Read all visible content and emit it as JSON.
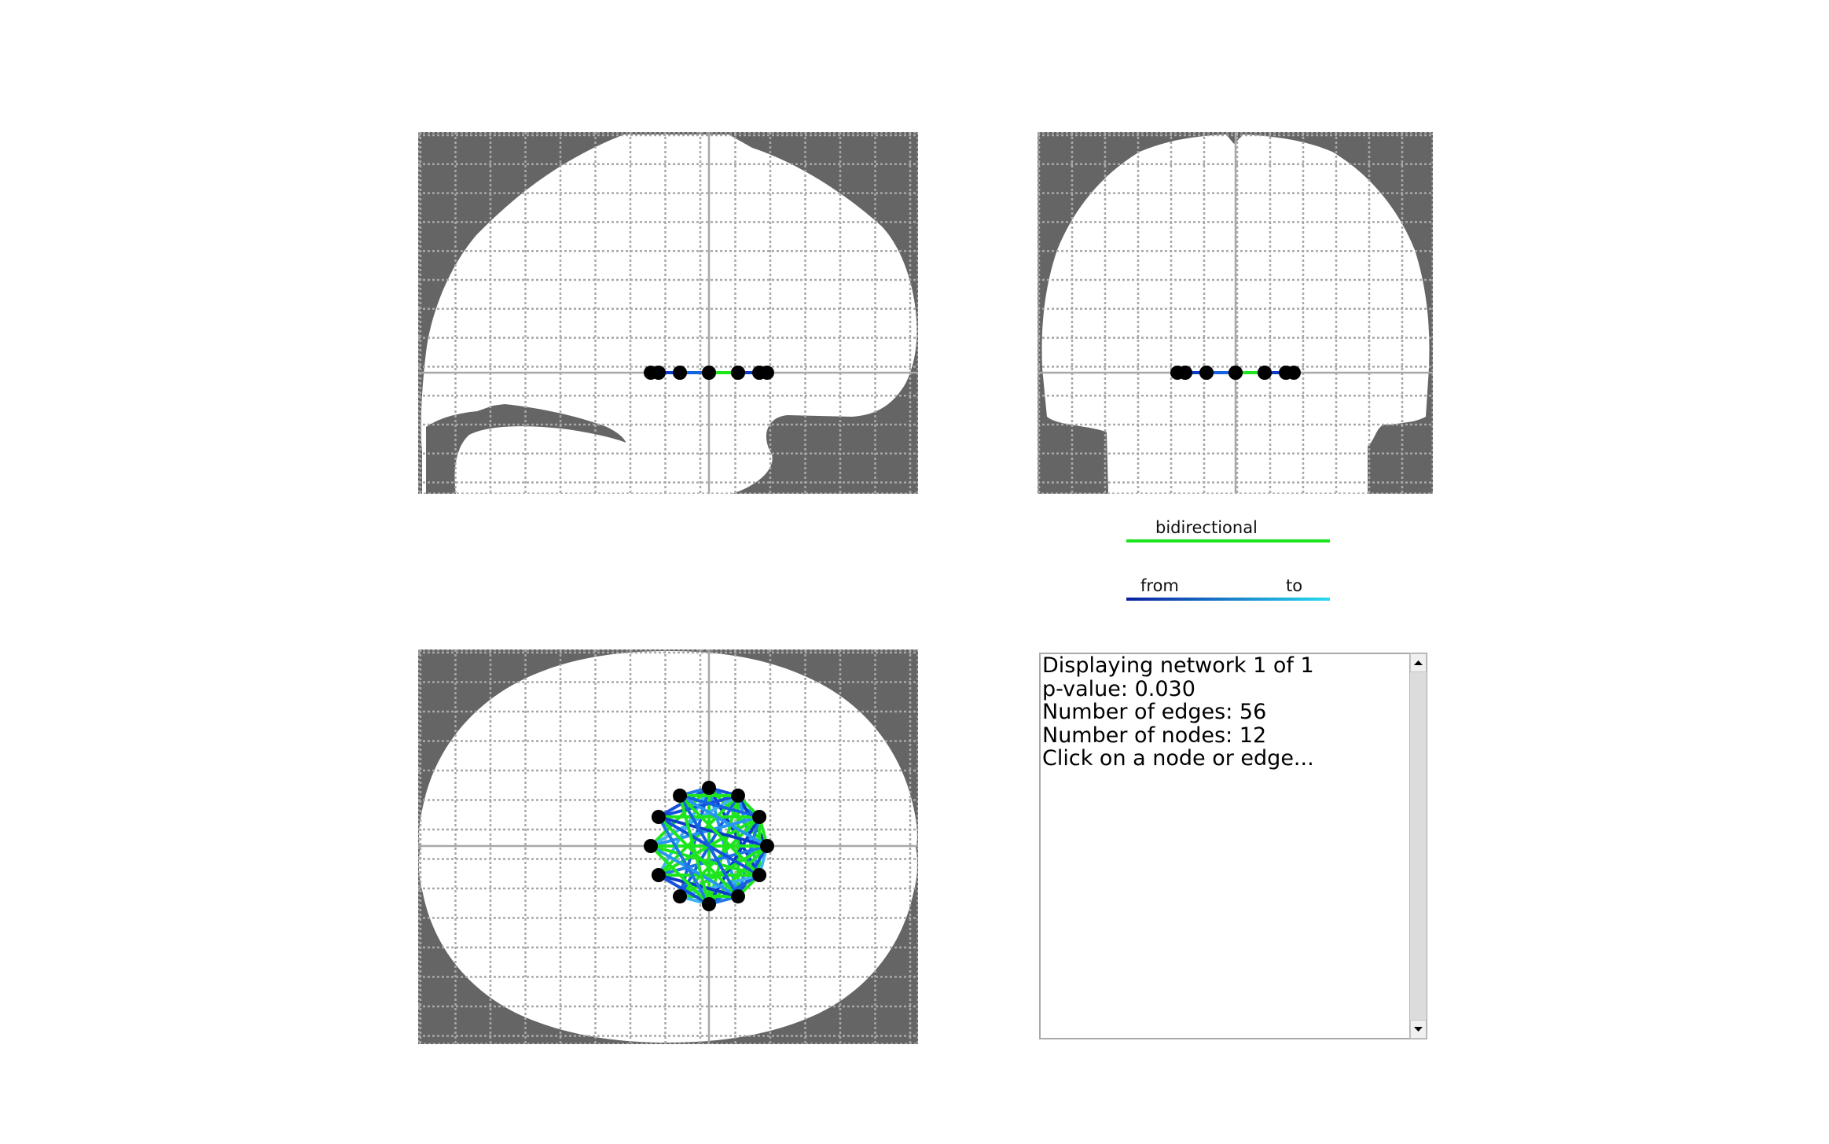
{
  "window": {
    "title": ""
  },
  "legend": {
    "bidirectional_label": "bidirectional",
    "from_label": "from",
    "to_label": "to",
    "bidirectional_color": "#1ee61e",
    "from_color": "#0a1ea0",
    "to_color": "#28dcf0"
  },
  "colors": {
    "outside_brain": "#656565",
    "brain": "#ffffff",
    "grid": "#a8a8a8",
    "axis": "#a8a8a8",
    "node": "#000000",
    "edge_blue": "#1450dc",
    "edge_green": "#1ee61e"
  },
  "views": {
    "sagittal": {
      "name": "sagittal-view"
    },
    "coronal": {
      "name": "coronal-view"
    },
    "axial": {
      "name": "axial-view"
    }
  },
  "info_panel": {
    "lines": [
      "Displaying network 1 of 1",
      "p-value: 0.030",
      "Number of edges: 56",
      "Number of nodes: 12",
      "Click on a node or edge..."
    ]
  },
  "network": {
    "node_count": 12,
    "edge_count": 56
  }
}
